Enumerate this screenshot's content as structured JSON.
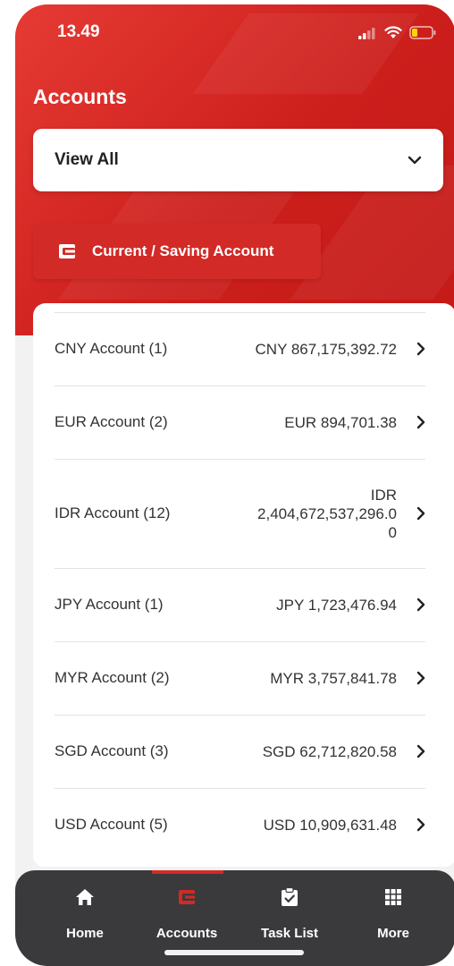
{
  "status": {
    "time": "13.49"
  },
  "header": {
    "title": "Accounts"
  },
  "filter": {
    "selected": "View All"
  },
  "account_tab": {
    "label": "Current / Saving Account"
  },
  "accounts": [
    {
      "name": "CNY Account (1)",
      "amount": "CNY 867,175,392.72"
    },
    {
      "name": "EUR Account (2)",
      "amount": "EUR 894,701.38"
    },
    {
      "name": "IDR Account (12)",
      "amount_lines": [
        "IDR",
        "2,404,672,537,296.0",
        "0"
      ]
    },
    {
      "name": "JPY Account (1)",
      "amount": "JPY 1,723,476.94"
    },
    {
      "name": "MYR Account (2)",
      "amount": "MYR 3,757,841.78"
    },
    {
      "name": "SGD Account (3)",
      "amount": "SGD 62,712,820.58"
    },
    {
      "name": "USD Account (5)",
      "amount": "USD 10,909,631.48"
    }
  ],
  "nav": {
    "items": [
      {
        "label": "Home",
        "icon": "home-icon"
      },
      {
        "label": "Accounts",
        "icon": "wallet-icon",
        "active": true
      },
      {
        "label": "Task List",
        "icon": "clipboard-check-icon"
      },
      {
        "label": "More",
        "icon": "grid-icon"
      }
    ]
  },
  "colors": {
    "brand_red": "#d22a26",
    "nav_bg": "#3a3a3c"
  }
}
